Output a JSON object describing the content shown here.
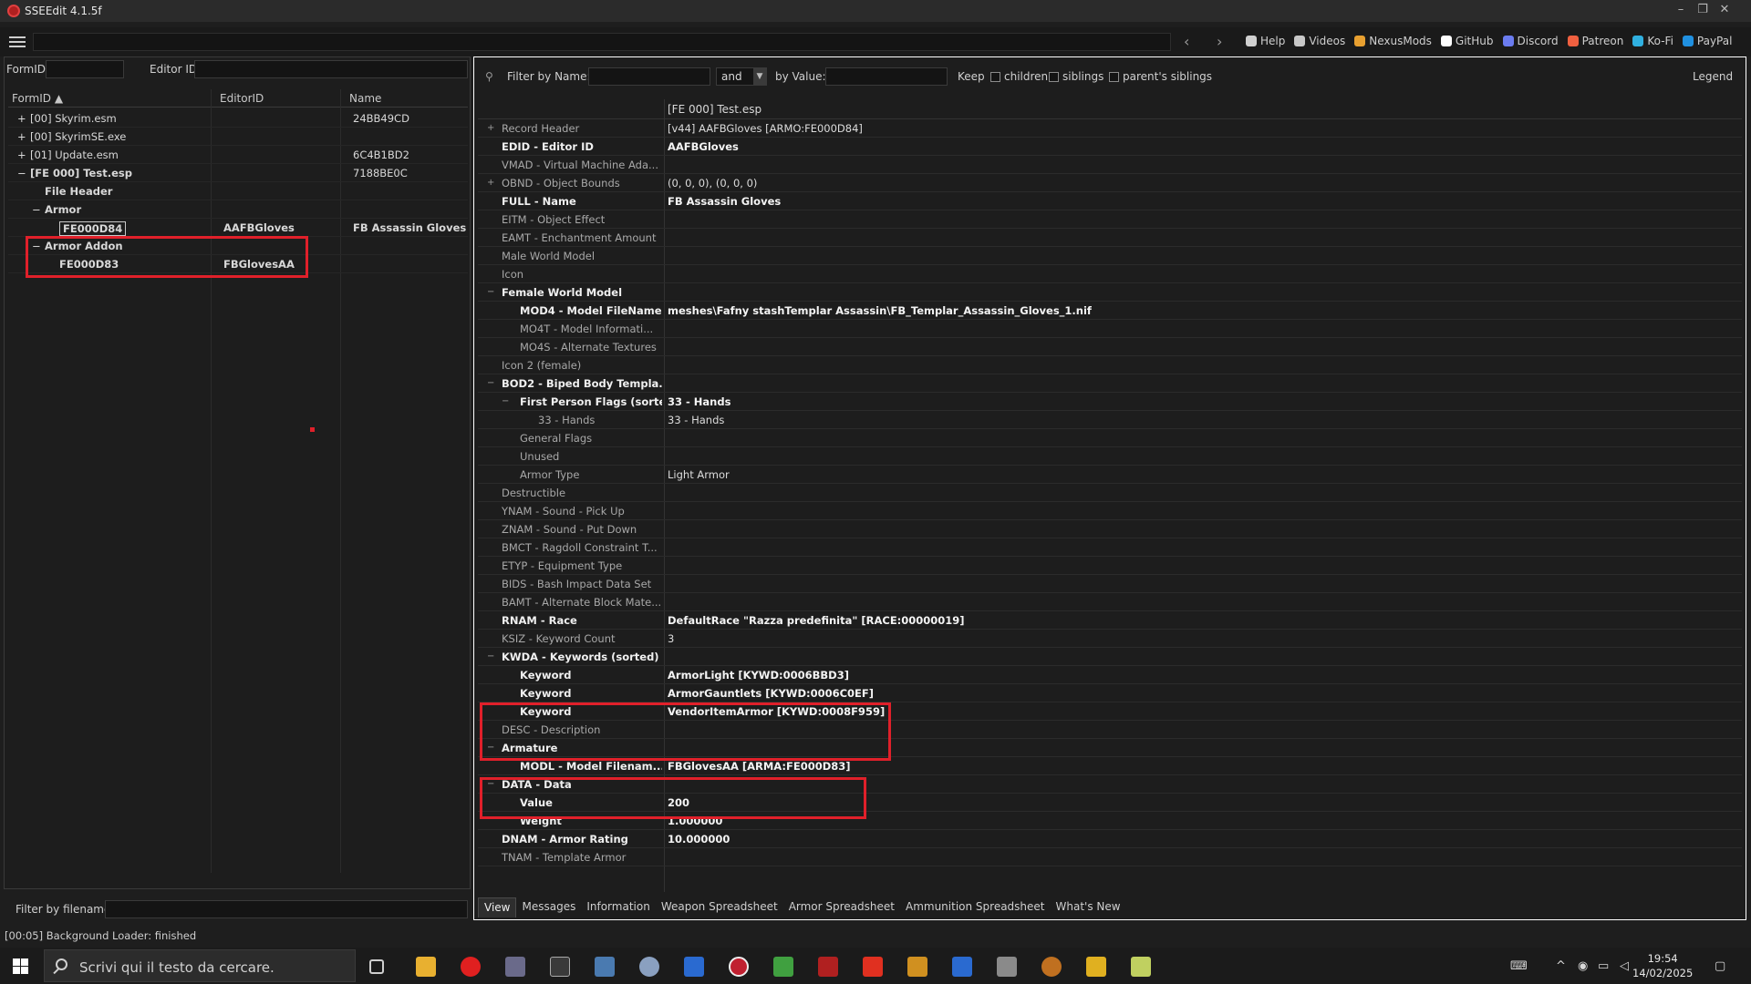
{
  "window": {
    "title": "SSEEdit 4.1.5f"
  },
  "toplinks": [
    {
      "label": "Help",
      "icon": "book-icon",
      "color": "#d0d0d0"
    },
    {
      "label": "Videos",
      "icon": "video-icon",
      "color": "#c8c8c8"
    },
    {
      "label": "NexusMods",
      "icon": "nexusmods-icon",
      "color": "#e8a030"
    },
    {
      "label": "GitHub",
      "icon": "github-icon",
      "color": "#ffffff"
    },
    {
      "label": "Discord",
      "icon": "discord-icon",
      "color": "#6b7cf0"
    },
    {
      "label": "Patreon",
      "icon": "patreon-icon",
      "color": "#f06040"
    },
    {
      "label": "Ko-Fi",
      "icon": "kofi-icon",
      "color": "#30b0e0"
    },
    {
      "label": "PayPal",
      "icon": "paypal-icon",
      "color": "#2090e0"
    }
  ],
  "left": {
    "formid_label": "FormID",
    "editorid_label": "Editor ID",
    "columns": {
      "formid": "FormID",
      "editorid": "EditorID",
      "name": "Name"
    },
    "tree": [
      {
        "exp": "+",
        "label": "[00] Skyrim.esm",
        "editorid": "",
        "name": "24BB49CD",
        "bold": false,
        "selected": false
      },
      {
        "exp": "+",
        "label": "[00] SkyrimSE.exe",
        "editorid": "",
        "name": "",
        "bold": false,
        "selected": false
      },
      {
        "exp": "+",
        "label": "[01] Update.esm",
        "editorid": "",
        "name": "6C4B1BD2",
        "bold": false,
        "selected": false
      },
      {
        "exp": "−",
        "label": "[FE 000] Test.esp",
        "editorid": "",
        "name": "7188BE0C",
        "bold": true,
        "selected": false
      },
      {
        "exp": "",
        "label": "File Header",
        "editorid": "",
        "name": "",
        "bold": true,
        "selected": false
      },
      {
        "exp": "−",
        "label": "Armor",
        "editorid": "",
        "name": "",
        "bold": true,
        "selected": false
      },
      {
        "exp": "",
        "label": "FE000D84",
        "editorid": "AAFBGloves",
        "name": "FB Assassin Gloves",
        "bold": true,
        "selected": true
      },
      {
        "exp": "−",
        "label": "Armor Addon",
        "editorid": "",
        "name": "",
        "bold": true,
        "selected": false
      },
      {
        "exp": "",
        "label": "FE000D83",
        "editorid": "FBGlovesAA",
        "name": "",
        "bold": true,
        "selected": false
      }
    ],
    "filter_filename_label": "Filter by filename:"
  },
  "right": {
    "filter_name_label": "Filter by Name:",
    "and_value": "and",
    "by_value_label": "by Value:",
    "keep_label": "Keep",
    "children_label": "children",
    "siblings_label": "siblings",
    "parent_siblings_label": "parent's siblings",
    "legend_label": "Legend",
    "file_header": "[FE 000] Test.esp",
    "records": [
      {
        "exp": "+",
        "name": "Record Header",
        "value": "[v44] AAFBGloves [ARMO:FE000D84]",
        "nb": false,
        "vb": false
      },
      {
        "exp": "",
        "name": "EDID - Editor ID",
        "value": "AAFBGloves",
        "nb": true,
        "vb": true
      },
      {
        "exp": "",
        "name": "VMAD - Virtual Machine Ada...",
        "value": "",
        "nb": false,
        "vb": false
      },
      {
        "exp": "+",
        "name": "OBND - Object Bounds",
        "value": "(0, 0, 0), (0, 0, 0)",
        "nb": false,
        "vb": false
      },
      {
        "exp": "",
        "name": "FULL - Name",
        "value": "FB Assassin Gloves",
        "nb": true,
        "vb": true
      },
      {
        "exp": "",
        "name": "EITM - Object Effect",
        "value": "",
        "nb": false,
        "vb": false
      },
      {
        "exp": "",
        "name": "EAMT - Enchantment Amount",
        "value": "",
        "nb": false,
        "vb": false
      },
      {
        "exp": "",
        "name": "Male World Model",
        "value": "",
        "nb": false,
        "vb": false
      },
      {
        "exp": "",
        "name": "Icon",
        "value": "",
        "nb": false,
        "vb": false
      },
      {
        "exp": "−",
        "name": "Female World Model",
        "value": "",
        "nb": true,
        "vb": false
      },
      {
        "exp": "",
        "name": "MOD4 - Model FileName",
        "value": "meshes\\Fafny stashTemplar Assassin\\FB_Templar_Assassin_Gloves_1.nif",
        "nb": true,
        "vb": true
      },
      {
        "exp": "",
        "name": "MO4T - Model Informati...",
        "value": "",
        "nb": false,
        "vb": false
      },
      {
        "exp": "",
        "name": "MO4S - Alternate Textures",
        "value": "",
        "nb": false,
        "vb": false
      },
      {
        "exp": "",
        "name": "Icon 2 (female)",
        "value": "",
        "nb": false,
        "vb": false
      },
      {
        "exp": "−",
        "name": "BOD2 - Biped Body Templa...",
        "value": "",
        "nb": true,
        "vb": false
      },
      {
        "exp": "−",
        "name": "First Person Flags (sorted)",
        "value": "33 - Hands",
        "nb": true,
        "vb": true
      },
      {
        "exp": "",
        "name": "33 - Hands",
        "value": "33 - Hands",
        "nb": false,
        "vb": false
      },
      {
        "exp": "",
        "name": "General Flags",
        "value": "",
        "nb": false,
        "vb": false
      },
      {
        "exp": "",
        "name": "Unused",
        "value": "",
        "nb": false,
        "vb": false
      },
      {
        "exp": "",
        "name": "Armor Type",
        "value": "Light Armor",
        "nb": false,
        "vb": false
      },
      {
        "exp": "",
        "name": "Destructible",
        "value": "",
        "nb": false,
        "vb": false
      },
      {
        "exp": "",
        "name": "YNAM - Sound - Pick Up",
        "value": "",
        "nb": false,
        "vb": false
      },
      {
        "exp": "",
        "name": "ZNAM - Sound - Put Down",
        "value": "",
        "nb": false,
        "vb": false
      },
      {
        "exp": "",
        "name": "BMCT - Ragdoll Constraint T...",
        "value": "",
        "nb": false,
        "vb": false
      },
      {
        "exp": "",
        "name": "ETYP - Equipment Type",
        "value": "",
        "nb": false,
        "vb": false
      },
      {
        "exp": "",
        "name": "BIDS - Bash Impact Data Set",
        "value": "",
        "nb": false,
        "vb": false
      },
      {
        "exp": "",
        "name": "BAMT - Alternate Block Mate...",
        "value": "",
        "nb": false,
        "vb": false
      },
      {
        "exp": "",
        "name": "RNAM - Race",
        "value": "DefaultRace \"Razza predefinita\" [RACE:00000019]",
        "nb": true,
        "vb": true
      },
      {
        "exp": "",
        "name": "KSIZ - Keyword Count",
        "value": "3",
        "nb": false,
        "vb": false
      },
      {
        "exp": "−",
        "name": "KWDA - Keywords (sorted)",
        "value": "",
        "nb": true,
        "vb": false
      },
      {
        "exp": "",
        "name": "Keyword",
        "value": "ArmorLight [KYWD:0006BBD3]",
        "nb": true,
        "vb": true
      },
      {
        "exp": "",
        "name": "Keyword",
        "value": "ArmorGauntlets [KYWD:0006C0EF]",
        "nb": true,
        "vb": true
      },
      {
        "exp": "",
        "name": "Keyword",
        "value": "VendorItemArmor [KYWD:0008F959]",
        "nb": true,
        "vb": true
      },
      {
        "exp": "",
        "name": "DESC - Description",
        "value": "",
        "nb": false,
        "vb": false
      },
      {
        "exp": "−",
        "name": "Armature",
        "value": "",
        "nb": true,
        "vb": false
      },
      {
        "exp": "",
        "name": "MODL - Model Filenam...",
        "value": "FBGlovesAA [ARMA:FE000D83]",
        "nb": true,
        "vb": true
      },
      {
        "exp": "−",
        "name": "DATA - Data",
        "value": "",
        "nb": true,
        "vb": false
      },
      {
        "exp": "",
        "name": "Value",
        "value": "200",
        "nb": true,
        "vb": true
      },
      {
        "exp": "",
        "name": "Weight",
        "value": "1.000000",
        "nb": true,
        "vb": true
      },
      {
        "exp": "",
        "name": "DNAM - Armor Rating",
        "value": "10.000000",
        "nb": true,
        "vb": true
      },
      {
        "exp": "",
        "name": "TNAM - Template Armor",
        "value": "",
        "nb": false,
        "vb": false
      }
    ],
    "tabs": [
      "View",
      "Messages",
      "Information",
      "Weapon Spreadsheet",
      "Armor Spreadsheet",
      "Ammunition Spreadsheet",
      "What's New"
    ],
    "active_tab": "View"
  },
  "status": {
    "text": "[00:05] Background Loader: finished"
  },
  "taskbar": {
    "search_placeholder": "Scrivi qui il testo da cercare.",
    "time": "19:54",
    "date": "14/02/2025"
  }
}
